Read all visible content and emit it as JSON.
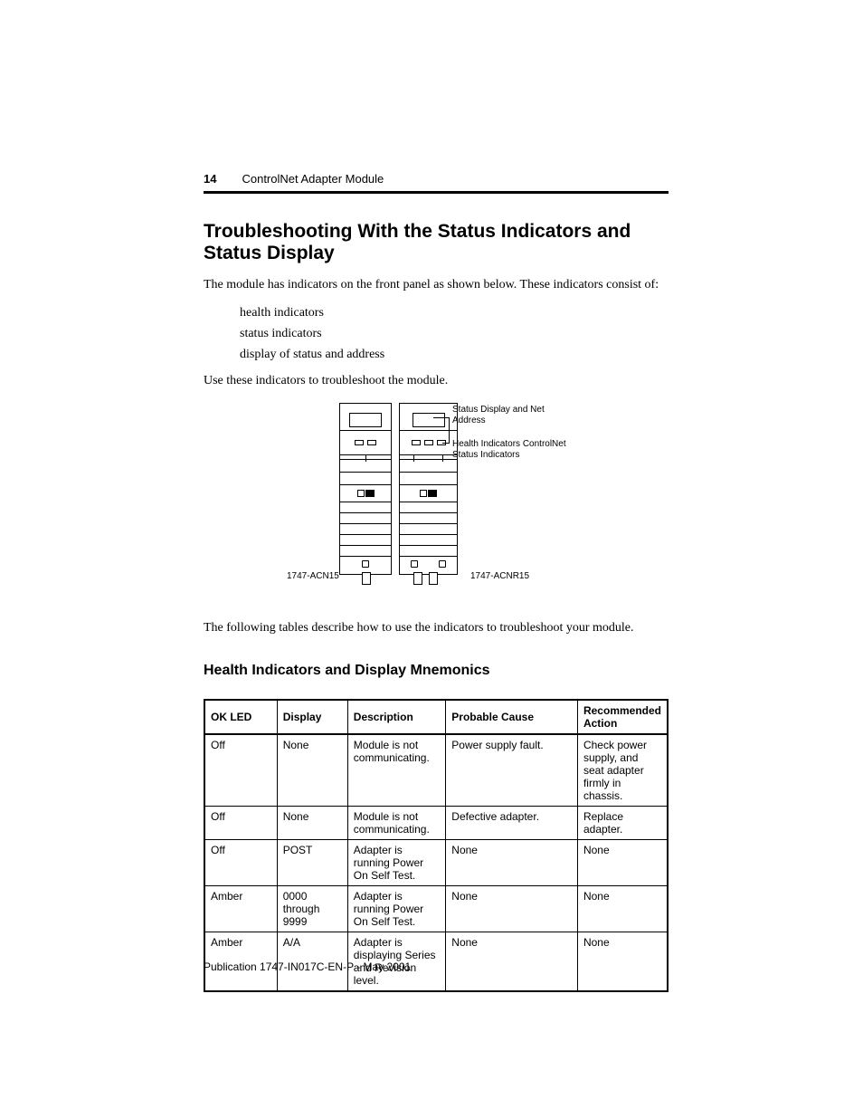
{
  "header": {
    "page_number": "14",
    "doc_title": "ControlNet Adapter Module"
  },
  "section_title": "Troubleshooting With the Status Indicators and Status Display",
  "intro_para": "The module has indicators on the front panel as shown below. These indicators consist of:",
  "bullets": [
    "health indicators",
    "status indicators",
    "display of status and address"
  ],
  "use_line": "Use these indicators to troubleshoot the module.",
  "diagram_labels": {
    "left_model": "1747-ACN15",
    "right_model": "1747-ACNR15",
    "status_display": "Status Display and Net Address",
    "health_ind": "Health Indicators ControlNet Status Indicators"
  },
  "tables_intro": "The following tables describe how to use the indicators to troubleshoot your module.",
  "subhead": "Health Indicators and Display Mnemonics",
  "table": {
    "headers": [
      "OK LED",
      "Display",
      "Description",
      "Probable Cause",
      "Recommended Action"
    ],
    "rows": [
      [
        "Off",
        "None",
        "Module is not communicating.",
        "Power supply fault.",
        "Check power supply, and seat adapter firmly in chassis."
      ],
      [
        "Off",
        "None",
        "Module is not communicating.",
        "Defective adapter.",
        "Replace adapter."
      ],
      [
        "Off",
        "POST",
        "Adapter is running Power On Self Test.",
        "None",
        "None"
      ],
      [
        "Amber",
        "0000 through 9999",
        "Adapter is running Power On Self Test.",
        "None",
        "None"
      ],
      [
        "Amber",
        "A/A",
        "Adapter is displaying Series and Revision level.",
        "None",
        "None"
      ]
    ]
  },
  "footer": "Publication 1747-IN017C-EN-P - May 2001"
}
